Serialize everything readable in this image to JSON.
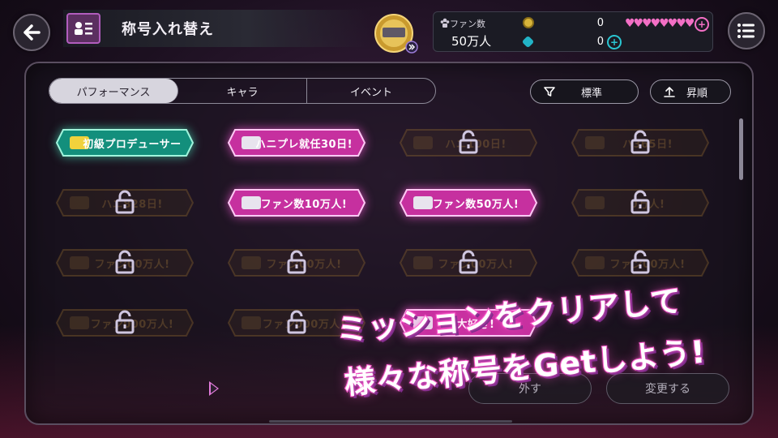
{
  "header": {
    "title": "称号入れ替え",
    "fan_label": "ファン数",
    "fan_value": "50万人",
    "coin_value": "0",
    "gem_value": "0",
    "back_icon": "back-arrow-icon",
    "menu_icon": "menu-list-icon"
  },
  "tabs": [
    {
      "label": "パフォーマンス",
      "active": true
    },
    {
      "label": "キャラ",
      "active": false
    },
    {
      "label": "イベント",
      "active": false
    }
  ],
  "sort": {
    "filter_label": "標準",
    "order_label": "昇順"
  },
  "plates": [
    {
      "label": "初級プロデューサー",
      "state": "unlocked",
      "style": "green"
    },
    {
      "label": "ハニプレ就任30日!",
      "state": "unlocked",
      "style": "pink"
    },
    {
      "label": "ハニ100日!",
      "state": "locked"
    },
    {
      "label": "ハ365日!",
      "state": "locked"
    },
    {
      "label": "ハニ828日!",
      "state": "locked"
    },
    {
      "label": "ファン数10万人!",
      "state": "unlocked",
      "style": "pink"
    },
    {
      "label": "ファン数50万人!",
      "state": "unlocked",
      "style": "pink"
    },
    {
      "label": "0万人!",
      "state": "locked"
    },
    {
      "label": "ファン00万人!",
      "state": "locked"
    },
    {
      "label": "ファン00万人!",
      "state": "locked"
    },
    {
      "label": "ファン00万人!",
      "state": "locked"
    },
    {
      "label": "ファン00万人!",
      "state": "locked"
    },
    {
      "label": "ファン000万人!",
      "state": "locked"
    },
    {
      "label": "ファン000万人!",
      "state": "locked"
    },
    {
      "label": "大好き!",
      "state": "unlocked",
      "style": "pink"
    }
  ],
  "buttons": {
    "remove_label": "外す",
    "change_label": "変更する"
  },
  "promo": {
    "line1": "ミッションをクリアして",
    "line2": "様々な称号をGetしよう!"
  },
  "colors": {
    "accent_pink": "#e24fd6",
    "accent_green": "#19b89a",
    "panel_border": "#5a4e60"
  }
}
